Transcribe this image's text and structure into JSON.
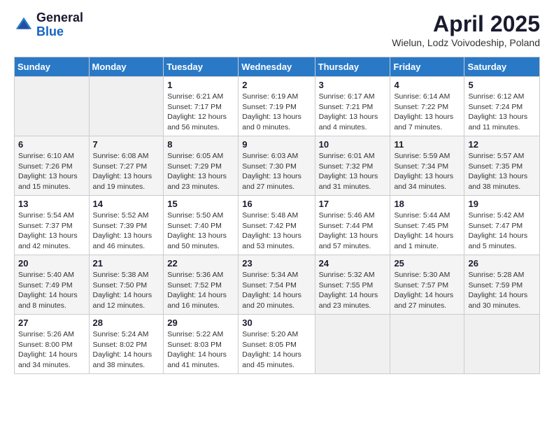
{
  "header": {
    "logo": {
      "general": "General",
      "blue": "Blue"
    },
    "title": "April 2025",
    "location": "Wielun, Lodz Voivodeship, Poland"
  },
  "days_of_week": [
    "Sunday",
    "Monday",
    "Tuesday",
    "Wednesday",
    "Thursday",
    "Friday",
    "Saturday"
  ],
  "weeks": [
    [
      {
        "day": "",
        "info": ""
      },
      {
        "day": "",
        "info": ""
      },
      {
        "day": "1",
        "info": "Sunrise: 6:21 AM\nSunset: 7:17 PM\nDaylight: 12 hours and 56 minutes."
      },
      {
        "day": "2",
        "info": "Sunrise: 6:19 AM\nSunset: 7:19 PM\nDaylight: 13 hours and 0 minutes."
      },
      {
        "day": "3",
        "info": "Sunrise: 6:17 AM\nSunset: 7:21 PM\nDaylight: 13 hours and 4 minutes."
      },
      {
        "day": "4",
        "info": "Sunrise: 6:14 AM\nSunset: 7:22 PM\nDaylight: 13 hours and 7 minutes."
      },
      {
        "day": "5",
        "info": "Sunrise: 6:12 AM\nSunset: 7:24 PM\nDaylight: 13 hours and 11 minutes."
      }
    ],
    [
      {
        "day": "6",
        "info": "Sunrise: 6:10 AM\nSunset: 7:26 PM\nDaylight: 13 hours and 15 minutes."
      },
      {
        "day": "7",
        "info": "Sunrise: 6:08 AM\nSunset: 7:27 PM\nDaylight: 13 hours and 19 minutes."
      },
      {
        "day": "8",
        "info": "Sunrise: 6:05 AM\nSunset: 7:29 PM\nDaylight: 13 hours and 23 minutes."
      },
      {
        "day": "9",
        "info": "Sunrise: 6:03 AM\nSunset: 7:30 PM\nDaylight: 13 hours and 27 minutes."
      },
      {
        "day": "10",
        "info": "Sunrise: 6:01 AM\nSunset: 7:32 PM\nDaylight: 13 hours and 31 minutes."
      },
      {
        "day": "11",
        "info": "Sunrise: 5:59 AM\nSunset: 7:34 PM\nDaylight: 13 hours and 34 minutes."
      },
      {
        "day": "12",
        "info": "Sunrise: 5:57 AM\nSunset: 7:35 PM\nDaylight: 13 hours and 38 minutes."
      }
    ],
    [
      {
        "day": "13",
        "info": "Sunrise: 5:54 AM\nSunset: 7:37 PM\nDaylight: 13 hours and 42 minutes."
      },
      {
        "day": "14",
        "info": "Sunrise: 5:52 AM\nSunset: 7:39 PM\nDaylight: 13 hours and 46 minutes."
      },
      {
        "day": "15",
        "info": "Sunrise: 5:50 AM\nSunset: 7:40 PM\nDaylight: 13 hours and 50 minutes."
      },
      {
        "day": "16",
        "info": "Sunrise: 5:48 AM\nSunset: 7:42 PM\nDaylight: 13 hours and 53 minutes."
      },
      {
        "day": "17",
        "info": "Sunrise: 5:46 AM\nSunset: 7:44 PM\nDaylight: 13 hours and 57 minutes."
      },
      {
        "day": "18",
        "info": "Sunrise: 5:44 AM\nSunset: 7:45 PM\nDaylight: 14 hours and 1 minute."
      },
      {
        "day": "19",
        "info": "Sunrise: 5:42 AM\nSunset: 7:47 PM\nDaylight: 14 hours and 5 minutes."
      }
    ],
    [
      {
        "day": "20",
        "info": "Sunrise: 5:40 AM\nSunset: 7:49 PM\nDaylight: 14 hours and 8 minutes."
      },
      {
        "day": "21",
        "info": "Sunrise: 5:38 AM\nSunset: 7:50 PM\nDaylight: 14 hours and 12 minutes."
      },
      {
        "day": "22",
        "info": "Sunrise: 5:36 AM\nSunset: 7:52 PM\nDaylight: 14 hours and 16 minutes."
      },
      {
        "day": "23",
        "info": "Sunrise: 5:34 AM\nSunset: 7:54 PM\nDaylight: 14 hours and 20 minutes."
      },
      {
        "day": "24",
        "info": "Sunrise: 5:32 AM\nSunset: 7:55 PM\nDaylight: 14 hours and 23 minutes."
      },
      {
        "day": "25",
        "info": "Sunrise: 5:30 AM\nSunset: 7:57 PM\nDaylight: 14 hours and 27 minutes."
      },
      {
        "day": "26",
        "info": "Sunrise: 5:28 AM\nSunset: 7:59 PM\nDaylight: 14 hours and 30 minutes."
      }
    ],
    [
      {
        "day": "27",
        "info": "Sunrise: 5:26 AM\nSunset: 8:00 PM\nDaylight: 14 hours and 34 minutes."
      },
      {
        "day": "28",
        "info": "Sunrise: 5:24 AM\nSunset: 8:02 PM\nDaylight: 14 hours and 38 minutes."
      },
      {
        "day": "29",
        "info": "Sunrise: 5:22 AM\nSunset: 8:03 PM\nDaylight: 14 hours and 41 minutes."
      },
      {
        "day": "30",
        "info": "Sunrise: 5:20 AM\nSunset: 8:05 PM\nDaylight: 14 hours and 45 minutes."
      },
      {
        "day": "",
        "info": ""
      },
      {
        "day": "",
        "info": ""
      },
      {
        "day": "",
        "info": ""
      }
    ]
  ]
}
